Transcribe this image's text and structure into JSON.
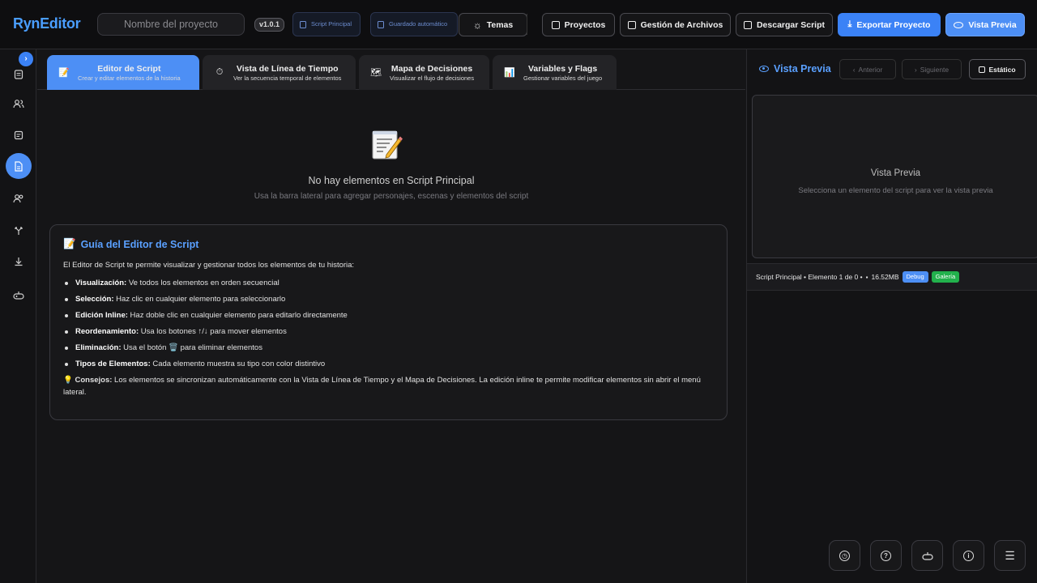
{
  "header": {
    "logo": "RynEditor",
    "project_placeholder": "Nombre del proyecto",
    "version": "v1.0.1",
    "script_chip": "Script Principal",
    "autosave_chip": "Guardado automático",
    "themes": "Temas",
    "projects": "Proyectos",
    "file_management": "Gestión de Archivos",
    "download_script": "Descargar Script",
    "export_project": "Exportar Proyecto",
    "preview": "Vista Previa"
  },
  "sidebar": {
    "toggle": "›",
    "icons": [
      "document-icon",
      "users-icon",
      "list-icon",
      "script-icon",
      "characters-icon",
      "branch-icon",
      "download-icon",
      "gamepad-icon"
    ]
  },
  "tabs": [
    {
      "label": "Editor de Script",
      "sub": "Crear y editar elementos de la historia",
      "icon": "📝"
    },
    {
      "label": "Vista de Línea de Tiempo",
      "sub": "Ver la secuencia temporal de elementos",
      "icon": "⏱"
    },
    {
      "label": "Mapa de Decisiones",
      "sub": "Visualizar el flujo de decisiones",
      "icon": "🗺"
    },
    {
      "label": "Variables y Flags",
      "sub": "Gestionar variables del juego",
      "icon": "📊"
    }
  ],
  "empty": {
    "title": "No hay elementos en Script Principal",
    "subtitle": "Usa la barra lateral para agregar personajes, escenas y elementos del script"
  },
  "guide": {
    "title": "Guía del Editor de Script",
    "intro": "El Editor de Script te permite visualizar y gestionar todos los elementos de tu historia:",
    "items": [
      {
        "term": "Visualización:",
        "text": " Ve todos los elementos en orden secuencial"
      },
      {
        "term": "Selección:",
        "text": " Haz clic en cualquier elemento para seleccionarlo"
      },
      {
        "term": "Edición Inline:",
        "text": " Haz doble clic en cualquier elemento para editarlo directamente"
      },
      {
        "term": "Reordenamiento:",
        "text": " Usa los botones ↑/↓ para mover elementos"
      },
      {
        "term": "Eliminación:",
        "text": " Usa el botón 🗑️ para eliminar elementos"
      },
      {
        "term": "Tipos de Elementos:",
        "text": " Cada elemento muestra su tipo con color distintivo"
      }
    ],
    "tip_term": "Consejos:",
    "tip_text": " Los elementos se sincronizan automáticamente con la Vista de Línea de Tiempo y el Mapa de Decisiones. La edición inline te permite modificar elementos sin abrir el menú lateral."
  },
  "preview": {
    "title": "Vista Previa",
    "prev": "Anterior",
    "next": "Siguiente",
    "static": "Estático",
    "box_title": "Vista Previa",
    "box_sub": "Selecciona un elemento del script para ver la vista previa",
    "status": "Script Principal • Elemento 1 de 0 •",
    "memory": "16.52MB",
    "debug": "Debug",
    "gallery": "Galería"
  },
  "bottom_buttons": [
    "history-icon",
    "help-icon",
    "gamepad-icon",
    "info-icon",
    "menu-icon"
  ]
}
